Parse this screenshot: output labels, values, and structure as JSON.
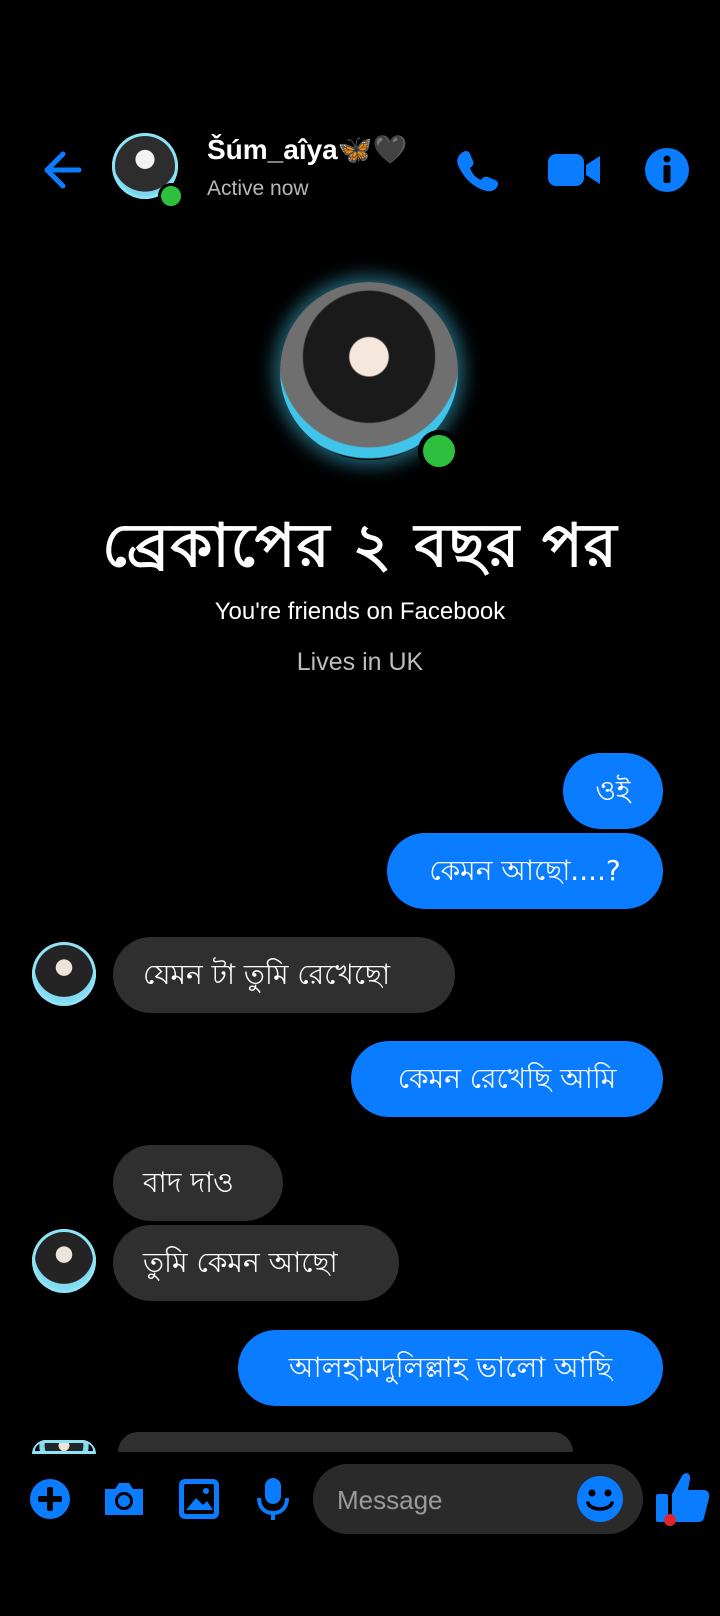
{
  "header": {
    "contact_name": "Šúm_aîya🦋🖤",
    "status": "Active now"
  },
  "profile": {
    "headline": "ব্রেকাপের ২ বছর পর",
    "friends_text": "You're friends on Facebook",
    "location_text": "Lives in UK"
  },
  "messages": [
    {
      "direction": "out",
      "text": "ওই"
    },
    {
      "direction": "out",
      "text": "কেমন আছো....?"
    },
    {
      "direction": "in",
      "text": "যেমন টা তুমি রেখেছো"
    },
    {
      "direction": "out",
      "text": "কেমন রেখেছি আমি"
    },
    {
      "direction": "in",
      "text": "বাদ দাও"
    },
    {
      "direction": "in",
      "text": "তুমি কেমন আছো"
    },
    {
      "direction": "out",
      "text": "আলহামদুলিল্লাহ ভালো আছি"
    }
  ],
  "composer": {
    "placeholder": "Message"
  },
  "colors": {
    "accent": "#0a7cff",
    "incoming_bubble": "#2f2f2f",
    "online": "#2fbf3f",
    "background": "#000000"
  },
  "icons": [
    "back-arrow-icon",
    "phone-icon",
    "video-camera-icon",
    "info-icon",
    "plus-icon",
    "camera-icon",
    "gallery-icon",
    "microphone-icon",
    "emoji-icon",
    "thumbs-up-icon"
  ]
}
